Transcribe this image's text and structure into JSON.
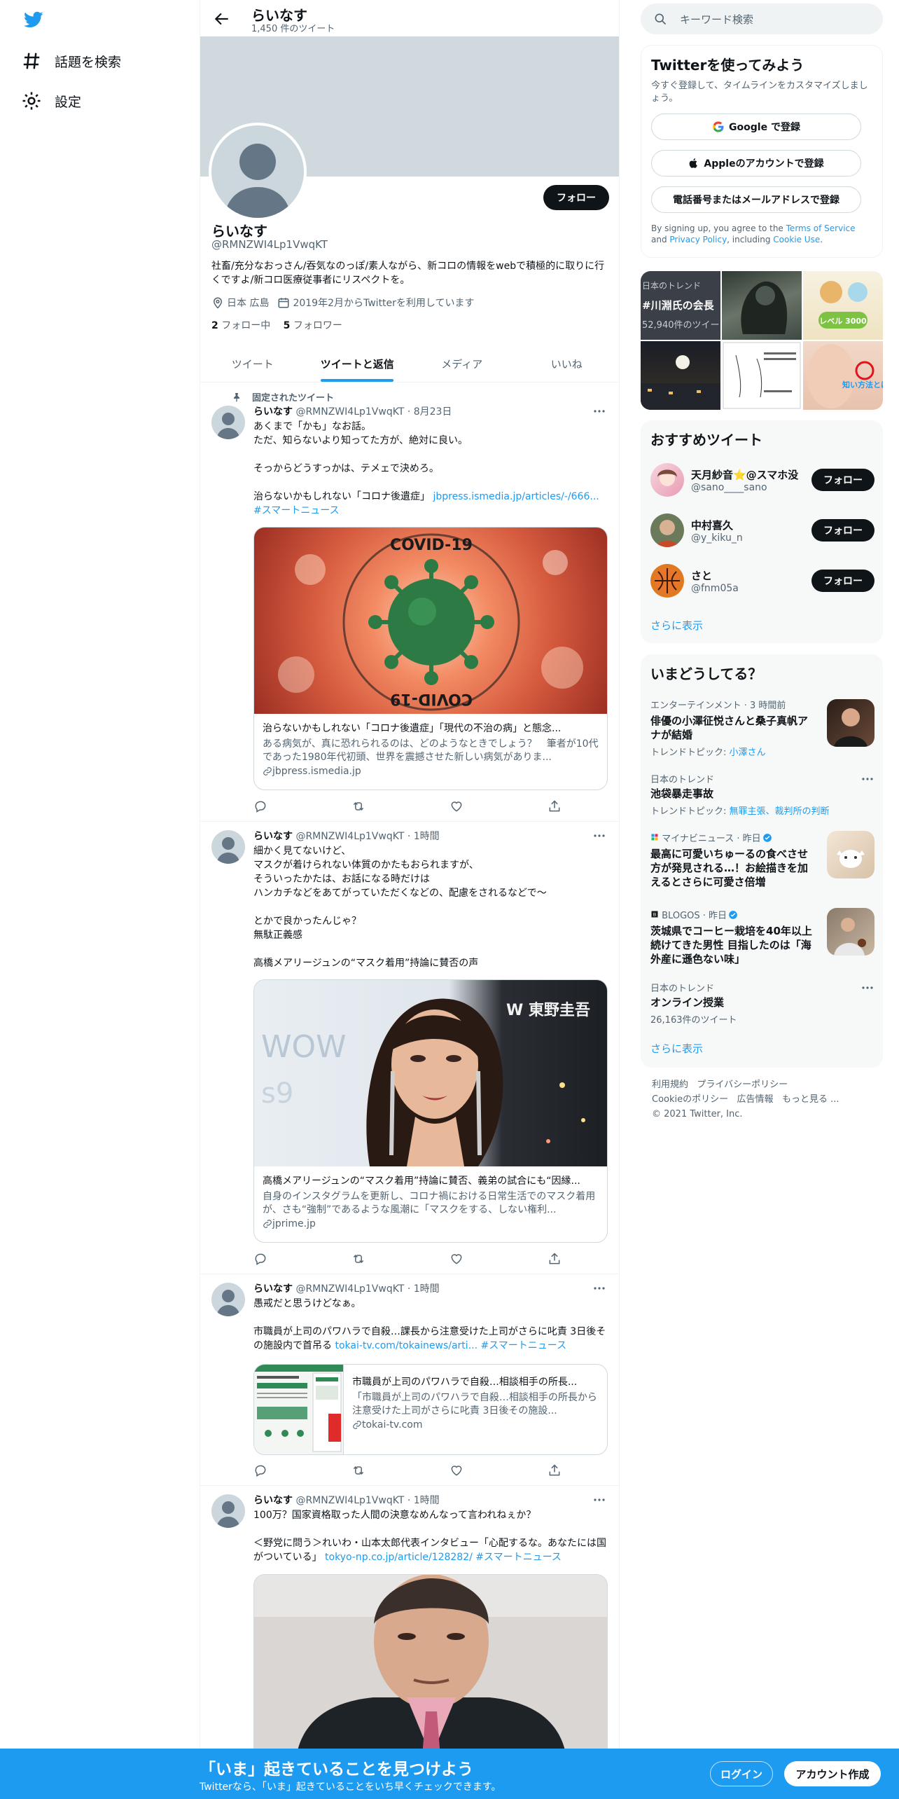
{
  "nav": {
    "explore_label": "話題を検索",
    "settings_label": "設定"
  },
  "header": {
    "name": "らいなす",
    "tweet_count": "1,450 件のツイート"
  },
  "profile": {
    "follow_label": "フォロー",
    "name": "らいなす",
    "handle": "@RMNZWI4Lp1VwqKT",
    "bio": "社畜/充分なおっさん/吞気なのっぽ/素人ながら、新コロの情報をwebで積極的に取りに行くですよ/新コロ医療従事者にリスペクトを。",
    "location": "日本 広島",
    "joined": "2019年2月からTwitterを利用しています",
    "following_count": "2",
    "following_label": "フォロー中",
    "followers_count": "5",
    "followers_label": "フォロワー"
  },
  "tabs": [
    {
      "label": "ツイート"
    },
    {
      "label": "ツイートと返信"
    },
    {
      "label": "メディア"
    },
    {
      "label": "いいね"
    }
  ],
  "tweets": [
    {
      "pinned_label": "固定されたツイート",
      "name": "らいなす",
      "handle": "@RMNZWI4Lp1VwqKT",
      "time": "· 8月23日",
      "text_plain": "あくまで「かも」なお話。\nただ、知らないより知ってた方が、絶対に良い。\n\nそっからどうすっかは、テメェで決めろ。\n\n治らないかもしれない「コロナ後遺症」 ",
      "link_text": "jbpress.ismedia.jp/articles/-/666... #スマートニュース",
      "card_title": "治らないかもしれない「コロナ後遺症」「現代の不治の病」と態念...",
      "card_desc": "ある病気が、真に恐れられるのは、どのようなときでしょう？　筆者が10代であった1980年代初頭、世界を震撼させた新しい病気がありま...",
      "card_domain": "jbpress.ismedia.jp",
      "image_overlay": "COVID-19"
    },
    {
      "name": "らいなす",
      "handle": "@RMNZWI4Lp1VwqKT",
      "time": "· 1時間",
      "text_plain": "細かく見てないけど、\nマスクが着けられない体質のかたもおられますが、\nそういったかたは、お話になる時だけは\nハンカチなどをあてがっていただくなどの、配慮をされるなどで〜\n\nとかで良かったんじゃ？\n無駄正義感\n\n高橋メアリージュンの“マスク着用”持論に賛否の声",
      "card_title": "高橋メアリージュンの“マスク着用”持論に賛否、義弟の試合にも“因縁...",
      "card_desc": "自身のインスタグラムを更新し、コロナ禍における日常生活でのマスク着用が、さも“強制”であるような風潮に「マスクをする、しない権利...",
      "card_domain": "jprime.jp",
      "image_overlay": "W 東野圭吾"
    },
    {
      "name": "らいなす",
      "handle": "@RMNZWI4Lp1VwqKT",
      "time": "· 1時間",
      "text_plain": "愚戒だと思うけどなぁ。\n\n市職員が上司のパワハラで自殺…課長から注意受けた上司がさらに叱責 3日後その施設内で首吊る ",
      "link_text": "tokai-tv.com/tokainews/arti... #スマートニュース",
      "card_title": "市職員が上司のパワハラで自殺…相談相手の所長...",
      "card_desc": "「市職員が上司のパワハラで自殺…相談相手の所長から注意受けた上司がさらに叱責 3日後その施設...",
      "card_domain": "tokai-tv.com"
    },
    {
      "name": "らいなす",
      "handle": "@RMNZWI4Lp1VwqKT",
      "time": "· 1時間",
      "text_plain": "100万？国家資格取った人間の決意なめんなって言われねぇか？\n\n＜野党に問う＞れいわ・山本太郎代表インタビュー「心配するな。あなたには国がついている」 ",
      "link_text": "tokyo-np.co.jp/article/128282/ #スマートニュース"
    }
  ],
  "right": {
    "search_placeholder": "キーワード検索",
    "try_title": "Twitterを使ってみよう",
    "try_sub": "今すぐ登録して、タイムラインをカスタマイズしましょう。",
    "google_label": "Google で登録",
    "apple_label": "Appleのアカウントで登録",
    "phone_label": "電話番号またはメールアドレスで登録",
    "legal_pre": "By signing up, you agree to the ",
    "terms": "Terms of Service",
    "and": " and ",
    "privacy": "Privacy Policy",
    "including": ", including ",
    "cookie": "Cookie Use",
    "period": ".",
    "media_trend_label": "日本のトレンド",
    "media_trend_name": "#川淵氏の会長",
    "media_trend_count": "52,940件のツイー",
    "media_badge": "レベル 3000",
    "media_tag": "知い方法とは",
    "rec_title": "おすすめツイート",
    "recs": [
      {
        "name": "天月紗音⭐@スマホ没",
        "handle": "@sano____sano",
        "btn": "フォロー"
      },
      {
        "name": "中村喜久",
        "handle": "@y_kiku_n",
        "btn": "フォロー"
      },
      {
        "name": "さと",
        "handle": "@fnm05a",
        "btn": "フォロー"
      }
    ],
    "show_more": "さらに表示",
    "trend_title": "いまどうしてる？",
    "trends": [
      {
        "meta": "エンターテインメント · 3 時間前",
        "name": "俳優の小澤征悦さんと桑子真帆アナが結婚",
        "sub_pre": "トレンドトピック: ",
        "sub_link": "小澤さん"
      },
      {
        "meta": "日本のトレンド",
        "name": "池袋暴走事故",
        "sub_pre": "トレンドトピック: ",
        "sub_link": "無罪主張、裁判所の判断"
      },
      {
        "meta": "マイナビニュース · 昨日",
        "name": "最高に可愛いちゅーるの食べさせ方が発見される…！お絵描きを加えるとさらに可愛さ倍増"
      },
      {
        "meta": "BLOGOS · 昨日",
        "name": "茨城県でコーヒー栽培を40年以上続けてきた男性 目指したのは「海外産に遜色ない味」"
      },
      {
        "meta": "日本のトレンド",
        "name": "オンライン授業",
        "sub_pre": "26,163件のツイート"
      }
    ],
    "show_more2": "さらに表示",
    "footer": {
      "terms": "利用規約",
      "privacy": "プライバシーポリシー",
      "cookie": "Cookieのポリシー",
      "ads": "広告情報",
      "more": "もっと見る ...",
      "copyright": "© 2021 Twitter, Inc."
    }
  },
  "bottombar": {
    "title": "「いま」起きていることを見つけよう",
    "sub": "Twitterなら、「いま」起きていることをいち早くチェックできます。",
    "login": "ログイン",
    "signup": "アカウント作成"
  },
  "colors": {
    "accent": "#1d9bf0",
    "text": "#0f1419",
    "muted": "#536471"
  },
  "icons": [
    "twitter-logo-icon",
    "hashtag-icon",
    "gear-icon",
    "back-arrow-icon",
    "location-icon",
    "calendar-icon",
    "pin-icon",
    "more-icon",
    "reply-icon",
    "retweet-icon",
    "like-icon",
    "share-icon",
    "link-icon",
    "search-icon",
    "google-icon",
    "apple-icon",
    "verified-icon"
  ]
}
